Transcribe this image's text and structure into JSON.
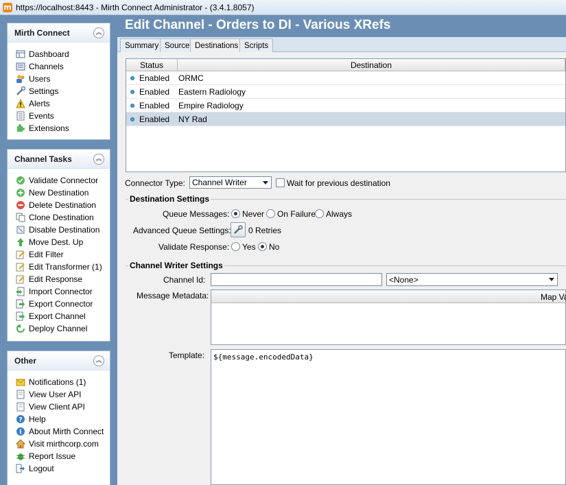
{
  "window": {
    "title": "https://localhost:8443 - Mirth Connect Administrator - (3.4.1.8057)"
  },
  "sidebar": {
    "mirth_connect": {
      "title": "Mirth Connect",
      "items": [
        {
          "label": "Dashboard",
          "icon": "dashboard-icon"
        },
        {
          "label": "Channels",
          "icon": "channels-icon"
        },
        {
          "label": "Users",
          "icon": "users-icon"
        },
        {
          "label": "Settings",
          "icon": "settings-icon"
        },
        {
          "label": "Alerts",
          "icon": "alerts-icon"
        },
        {
          "label": "Events",
          "icon": "events-icon"
        },
        {
          "label": "Extensions",
          "icon": "extensions-icon"
        }
      ]
    },
    "channel_tasks": {
      "title": "Channel Tasks",
      "items": [
        {
          "label": "Validate Connector",
          "icon": "check-icon"
        },
        {
          "label": "New Destination",
          "icon": "add-icon"
        },
        {
          "label": "Delete Destination",
          "icon": "delete-icon"
        },
        {
          "label": "Clone Destination",
          "icon": "clone-icon"
        },
        {
          "label": "Disable Destination",
          "icon": "disable-icon"
        },
        {
          "label": "Move Dest. Up",
          "icon": "arrow-up-icon"
        },
        {
          "label": "Edit Filter",
          "icon": "edit-icon"
        },
        {
          "label": "Edit Transformer (1)",
          "icon": "edit-icon"
        },
        {
          "label": "Edit Response",
          "icon": "edit-icon"
        },
        {
          "label": "Import Connector",
          "icon": "import-icon"
        },
        {
          "label": "Export Connector",
          "icon": "export-icon"
        },
        {
          "label": "Export Channel",
          "icon": "export-icon"
        },
        {
          "label": "Deploy Channel",
          "icon": "deploy-icon"
        }
      ]
    },
    "other": {
      "title": "Other",
      "items": [
        {
          "label": "Notifications (1)",
          "icon": "notifications-icon"
        },
        {
          "label": "View User API",
          "icon": "document-icon"
        },
        {
          "label": "View Client API",
          "icon": "document-icon"
        },
        {
          "label": "Help",
          "icon": "help-icon"
        },
        {
          "label": "About Mirth Connect",
          "icon": "info-icon"
        },
        {
          "label": "Visit mirthcorp.com",
          "icon": "home-icon"
        },
        {
          "label": "Report Issue",
          "icon": "bug-icon"
        },
        {
          "label": "Logout",
          "icon": "logout-icon"
        }
      ]
    }
  },
  "main": {
    "title": "Edit Channel - Orders to DI - Various XRefs",
    "tabs": [
      "Summary",
      "Source",
      "Destinations",
      "Scripts"
    ],
    "active_tab": "Destinations",
    "destinations_table": {
      "columns": [
        "Status",
        "Destination"
      ],
      "rows": [
        {
          "status": "Enabled",
          "name": "ORMC"
        },
        {
          "status": "Enabled",
          "name": "Eastern Radiology"
        },
        {
          "status": "Enabled",
          "name": "Empire Radiology"
        },
        {
          "status": "Enabled",
          "name": "NY Rad"
        }
      ],
      "selected_index": 3
    },
    "connector_type": {
      "label": "Connector Type:",
      "value": "Channel Writer"
    },
    "wait_previous": {
      "label": "Wait for previous destination",
      "checked": false
    },
    "destination_settings": {
      "title": "Destination Settings",
      "queue_messages": {
        "label": "Queue Messages:",
        "options": [
          "Never",
          "On Failure",
          "Always"
        ],
        "selected": "Never"
      },
      "advanced_queue": {
        "label": "Advanced Queue Settings:",
        "value": "0 Retries"
      },
      "validate_response": {
        "label": "Validate Response:",
        "options": [
          "Yes",
          "No"
        ],
        "selected": "No"
      }
    },
    "channel_writer_settings": {
      "title": "Channel Writer Settings",
      "channel_id": {
        "label": "Channel Id:",
        "value": "",
        "select_value": "<None>"
      },
      "message_metadata": {
        "label": "Message Metadata:",
        "column": "Map Variable"
      },
      "template": {
        "label": "Template:",
        "value": "${message.encodedData}"
      }
    }
  }
}
